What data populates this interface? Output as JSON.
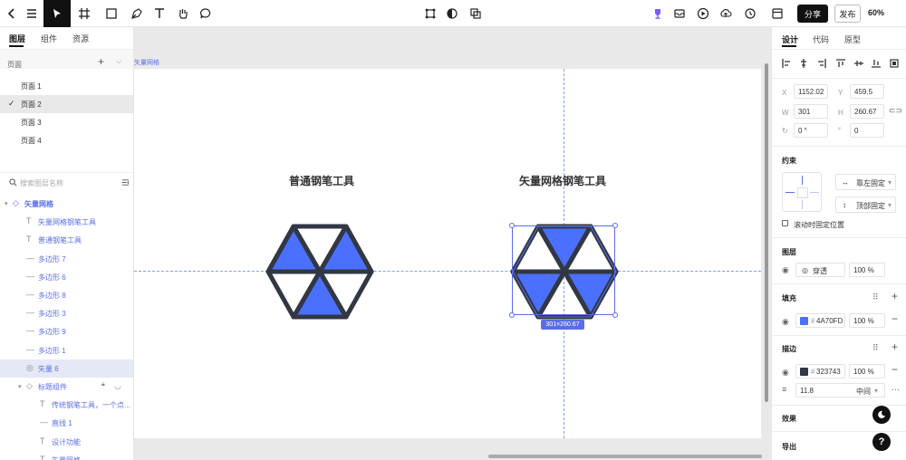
{
  "toolbar": {
    "share_label": "分享",
    "publish_label": "发布",
    "zoom": "60%"
  },
  "left": {
    "tabs": [
      "图层",
      "组件",
      "资源"
    ],
    "pages_title": "页面",
    "pages": [
      "页面 1",
      "页面 2",
      "页面 3",
      "页面 4"
    ],
    "search_placeholder": "搜索图层名称",
    "layers": [
      {
        "label": "矢量网格",
        "icon": "◇",
        "indent": 0
      },
      {
        "label": "矢量网格钢笔工具",
        "icon": "T",
        "indent": 1
      },
      {
        "label": "普通钢笔工具",
        "icon": "T",
        "indent": 1
      },
      {
        "label": "多边形 7",
        "icon": "—",
        "indent": 1
      },
      {
        "label": "多边形 6",
        "icon": "—",
        "indent": 1
      },
      {
        "label": "多边形 8",
        "icon": "—",
        "indent": 1
      },
      {
        "label": "多边形 3",
        "icon": "—",
        "indent": 1
      },
      {
        "label": "多边形 9",
        "icon": "—",
        "indent": 1
      },
      {
        "label": "多边形 1",
        "icon": "—",
        "indent": 1
      },
      {
        "label": "矢量 6",
        "icon": "◎",
        "indent": 1
      },
      {
        "label": "标题组件",
        "icon": "◇",
        "indent": 1
      },
      {
        "label": "传统钢笔工具，一个点...",
        "icon": "T",
        "indent": 2
      },
      {
        "label": "直线 1",
        "icon": "—",
        "indent": 2
      },
      {
        "label": "设计功能",
        "icon": "T",
        "indent": 2
      },
      {
        "label": "矢量网格",
        "icon": "T",
        "indent": 2
      }
    ]
  },
  "canvas": {
    "artboard_label": "矢量网格",
    "title_left": "普通钢笔工具",
    "title_right": "矢量网格钢笔工具",
    "dimension_badge": "301×260.67"
  },
  "right": {
    "tabs": [
      "设计",
      "代码",
      "原型"
    ],
    "x": "1152.02",
    "y": "459.5",
    "w": "301",
    "h": "260.67",
    "rotation": "0 °",
    "radius": "0",
    "labels": {
      "x": "X",
      "y": "Y",
      "w": "W",
      "h": "H"
    },
    "constraints_title": "约束",
    "constraint_h": "靠左固定",
    "constraint_v": "顶部固定",
    "fixed_scroll": "滚动时固定位置",
    "layer_title": "图层",
    "blend_mode": "穿透",
    "layer_opacity": "100 %",
    "fill_title": "填充",
    "fill_hex": "4A70FD",
    "fill_opacity": "100 %",
    "stroke_title": "描边",
    "stroke_hex": "323743",
    "stroke_opacity": "100 %",
    "stroke_width": "11.8",
    "stroke_position": "中间",
    "effects_title": "效果",
    "export_title": "导出"
  },
  "colors": {
    "fill": "#4A70FD",
    "stroke": "#323743",
    "accent": "#5A6DE8"
  }
}
